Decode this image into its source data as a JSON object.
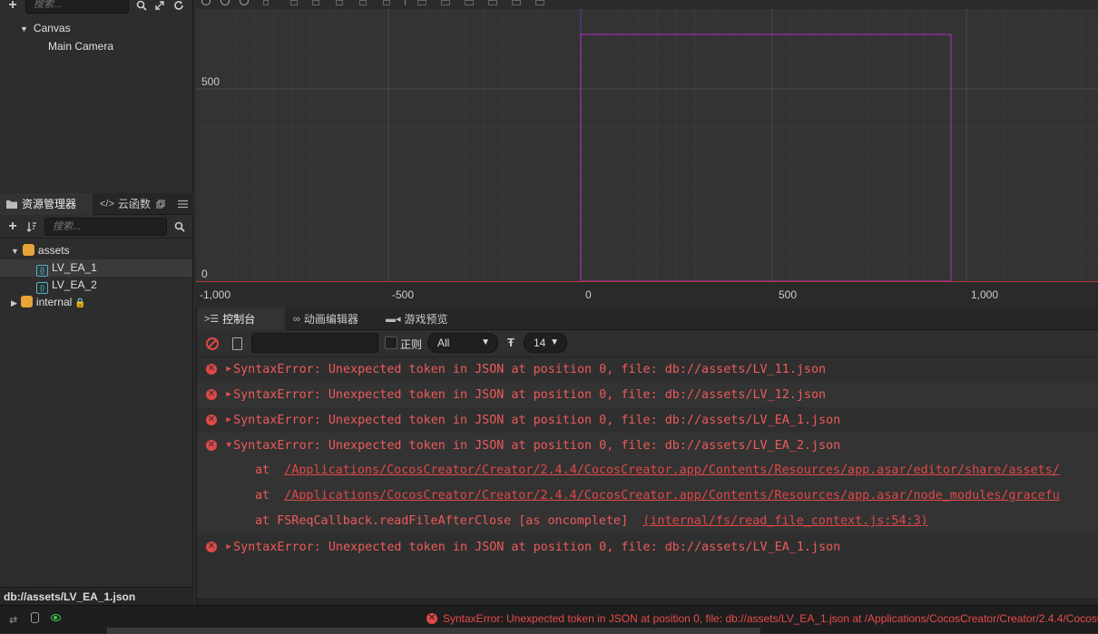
{
  "hierarchy": {
    "search_placeholder": "搜索...",
    "nodes": [
      {
        "label": "Canvas"
      },
      {
        "label": "Main Camera"
      }
    ]
  },
  "assets": {
    "tabs": [
      "资源管理器",
      "云函数"
    ],
    "search_placeholder": "搜索...",
    "tree": [
      {
        "label": "assets"
      },
      {
        "label": "LV_EA_1"
      },
      {
        "label": "LV_EA_2"
      },
      {
        "label": "internal"
      }
    ],
    "path": "db://assets/LV_EA_1.json"
  },
  "scene": {
    "y_labels": [
      "500",
      "0"
    ],
    "x_labels": [
      "-1,000",
      "-500",
      "0",
      "500",
      "1,000"
    ]
  },
  "console": {
    "tabs": [
      "控制台",
      "动画编辑器",
      "游戏预览"
    ],
    "regex_label": "正则",
    "level_select": "All",
    "font_size": "14",
    "logs": [
      {
        "text": "SyntaxError: Unexpected token  in JSON at position 0, file: db://assets/LV_11.json"
      },
      {
        "text": "SyntaxError: Unexpected token  in JSON at position 0, file: db://assets/LV_12.json"
      },
      {
        "text": "SyntaxError: Unexpected token  in JSON at position 0, file: db://assets/LV_EA_1.json"
      },
      {
        "text": "SyntaxError: Unexpected token  in JSON at position 0, file: db://assets/LV_EA_2.json"
      },
      {
        "text": "SyntaxError: Unexpected token  in JSON at position 0, file: db://assets/LV_EA_1.json"
      }
    ],
    "stack": [
      {
        "prefix": "at ",
        "link": "/Applications/CocosCreator/Creator/2.4.4/CocosCreator.app/Contents/Resources/app.asar/editor/share/assets/"
      },
      {
        "prefix": "at ",
        "link": "/Applications/CocosCreator/Creator/2.4.4/CocosCreator.app/Contents/Resources/app.asar/node_modules/gracefu"
      },
      {
        "prefix": "at FSReqCallback.readFileAfterClose [as oncomplete]  ",
        "link": "(internal/fs/read_file_context.js:54:3)"
      }
    ]
  },
  "status": {
    "message": "SyntaxError: Unexpected token  in JSON at position 0, file: db://assets/LV_EA_1.json at /Applications/CocosCreator/Creator/2.4.4/CocosC"
  },
  "colors": {
    "error": "#e84a4a",
    "accent_purple": "#b32fc9",
    "axis_red": "#b53a3a"
  }
}
